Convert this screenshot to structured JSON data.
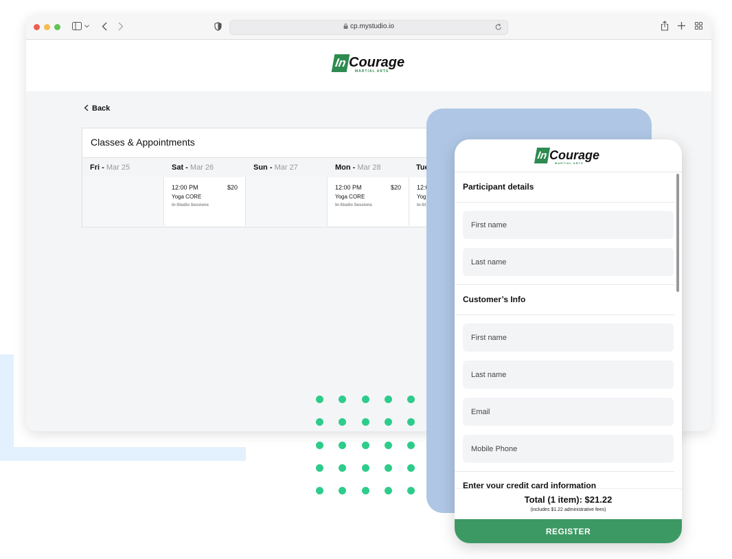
{
  "browser": {
    "url": "cp.mystudio.io",
    "icons": [
      "sidebar-icon",
      "chevron-down-icon",
      "back-arrow-icon",
      "forward-arrow-icon",
      "shield-icon",
      "lock-icon",
      "reload-icon",
      "share-icon",
      "plus-icon",
      "grid-icon"
    ]
  },
  "brand": {
    "mark": "In",
    "name": "Courage",
    "tagline": "MARTIAL ARTS",
    "color": "#2e8b50"
  },
  "nav": {
    "back_label": "Back"
  },
  "calendar": {
    "title": "Classes & Appointments",
    "days": [
      {
        "day": "Fri",
        "date": "Mar 25"
      },
      {
        "day": "Sat",
        "date": "Mar 26"
      },
      {
        "day": "Sun",
        "date": "Mar 27"
      },
      {
        "day": "Mon",
        "date": "Mar 28"
      },
      {
        "day": "Tue",
        "date": ""
      }
    ],
    "events": [
      {
        "time": "12:00 PM",
        "price": "$20",
        "name": "Yoga CORE",
        "type": "In-Studio Sessions"
      },
      {
        "time": "12:00 PM",
        "price": "$20",
        "name": "Yoga CORE",
        "type": "In-Studio Sessions"
      },
      {
        "time": "12:0",
        "name": "Yog",
        "type": "In-St"
      }
    ]
  },
  "form": {
    "participant_title": "Participant details",
    "participant_first": "First name",
    "participant_last": "Last name",
    "customer_title": "Customer’s Info",
    "customer_first": "First name",
    "customer_last": "Last name",
    "email": "Email",
    "phone": "Mobile Phone",
    "card_title": "Enter your credit card information",
    "total": "Total (1 item):  $21.22",
    "fee_note": "(includes $1.22 administrative fees)",
    "register_label": "REGISTER"
  },
  "colors": {
    "accent_green": "#3d9964",
    "dot_green": "#2ecc8a",
    "panel_blue": "#afc7e5",
    "deco_blue": "#e3f0fd"
  }
}
